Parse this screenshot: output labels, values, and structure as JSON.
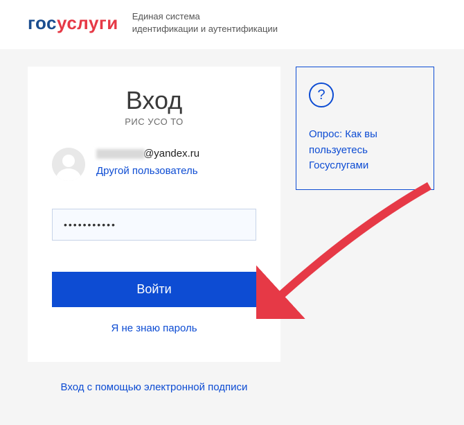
{
  "header": {
    "logo_gos": "гос",
    "logo_uslugi": "услуги",
    "tagline_line1": "Единая система",
    "tagline_line2": "идентификации и аутентификации"
  },
  "login": {
    "title": "Вход",
    "subtitle": "РИС УСО ТО",
    "email_visible": "@yandex.ru",
    "other_user": "Другой пользователь",
    "password_value": "•••••••••••",
    "button_label": "Войти",
    "forgot_label": "Я не знаю пароль"
  },
  "alt_login": {
    "label": "Вход с помощью электронной подписи"
  },
  "survey": {
    "icon_char": "?",
    "text": "Опрос: Как вы пользуетесь Госуслугами"
  }
}
